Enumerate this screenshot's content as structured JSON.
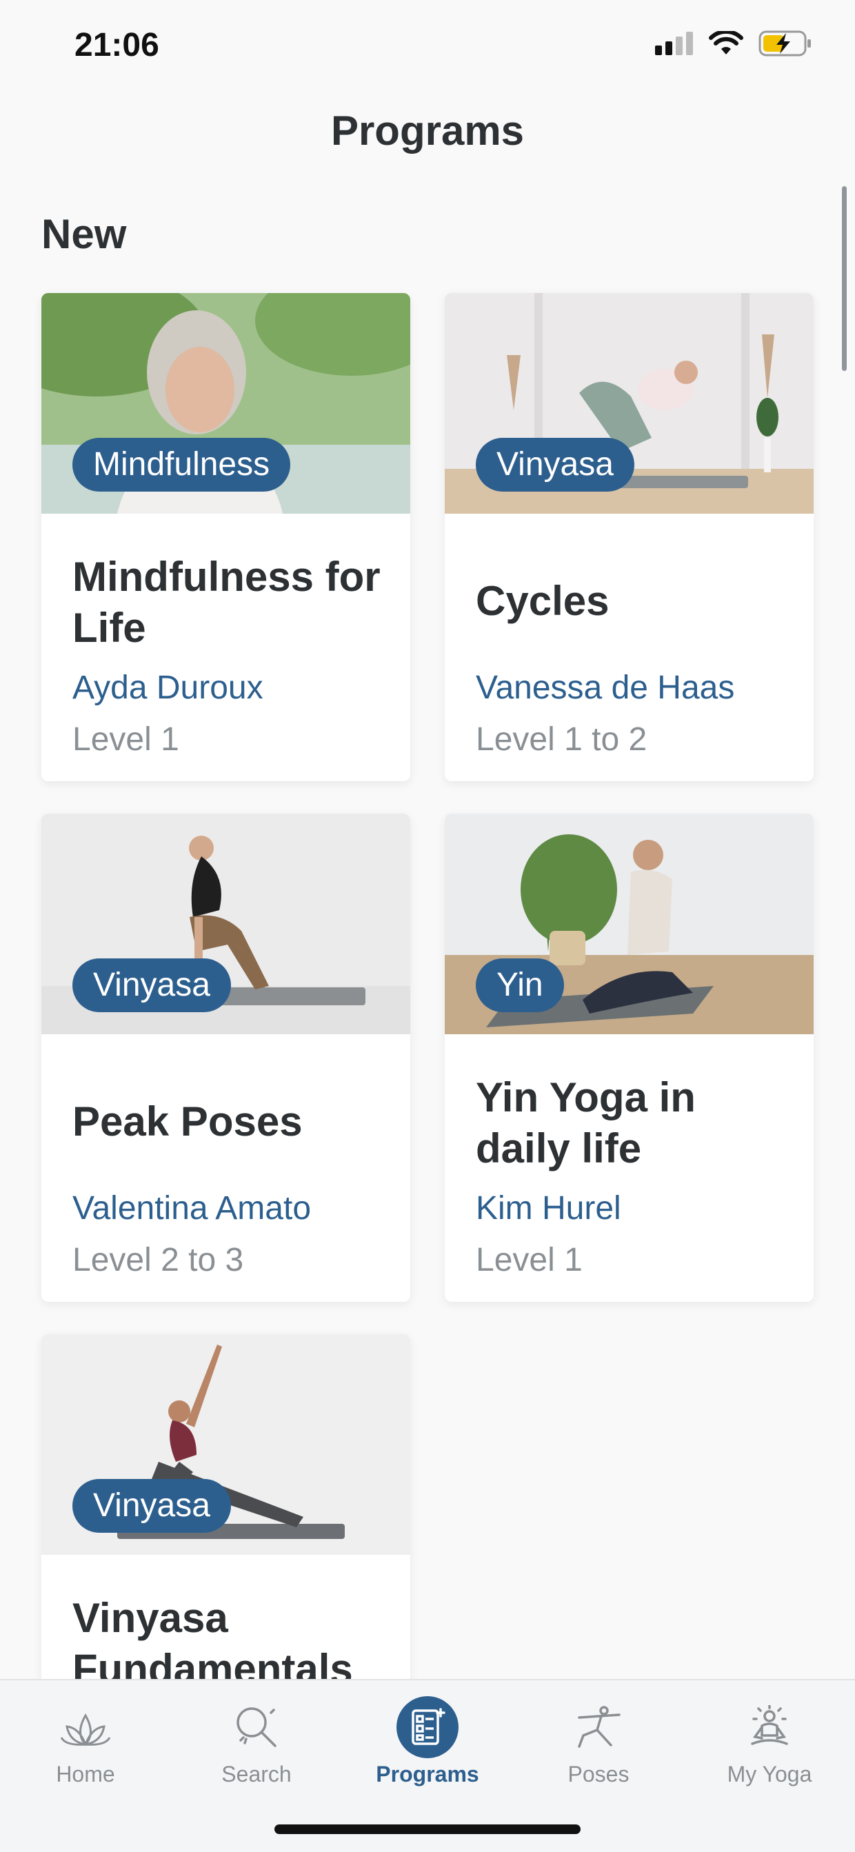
{
  "status_bar": {
    "time": "21:06"
  },
  "header": {
    "title": "Programs"
  },
  "section": {
    "title": "New"
  },
  "cards": [
    {
      "badge": "Mindfulness",
      "title": "Mindfulness for Life",
      "teacher": "Ayda Duroux",
      "level": "Level 1"
    },
    {
      "badge": "Vinyasa",
      "title": "Cycles",
      "teacher": "Vanessa de Haas",
      "level": "Level 1 to 2"
    },
    {
      "badge": "Vinyasa",
      "title": "Peak Poses",
      "teacher": "Valentina Amato",
      "level": "Level 2 to 3"
    },
    {
      "badge": "Yin",
      "title": "Yin Yoga in daily life",
      "teacher": "Kim Hurel",
      "level": "Level 1"
    },
    {
      "badge": "Vinyasa",
      "title": "Vinyasa Fundamentals",
      "teacher": "",
      "level": ""
    }
  ],
  "tabs": [
    {
      "label": "Home",
      "icon": "lotus-icon"
    },
    {
      "label": "Search",
      "icon": "search-icon"
    },
    {
      "label": "Programs",
      "icon": "programs-list-icon",
      "active": true
    },
    {
      "label": "Poses",
      "icon": "pose-figure-icon"
    },
    {
      "label": "My Yoga",
      "icon": "meditation-figure-icon"
    }
  ],
  "colors": {
    "accent": "#2d5f8e",
    "muted": "#8a8f94",
    "text": "#2d3134"
  }
}
